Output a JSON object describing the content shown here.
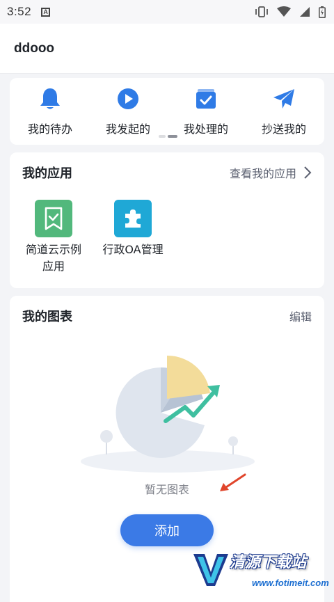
{
  "status_bar": {
    "time": "3:52",
    "icons": [
      "keyboard-a-icon",
      "vibrate-icon",
      "wifi-icon",
      "cell-signal-icon",
      "battery-icon"
    ]
  },
  "header": {
    "title": "ddooo"
  },
  "quick_actions": {
    "items": [
      {
        "label": "我的待办",
        "icon": "bell-icon"
      },
      {
        "label": "我发起的",
        "icon": "play-circle-icon"
      },
      {
        "label": "我处理的",
        "icon": "check-folder-icon"
      },
      {
        "label": "抄送我的",
        "icon": "paper-plane-icon"
      }
    ]
  },
  "my_apps": {
    "title": "我的应用",
    "view_all_label": "查看我的应用",
    "apps": [
      {
        "label": "简道云示例应用",
        "icon": "bookmark-check-icon",
        "color": "#52b87c"
      },
      {
        "label": "行政OA管理",
        "icon": "puzzle-icon",
        "color": "#1fa8d6"
      }
    ]
  },
  "my_charts": {
    "title": "我的图表",
    "edit_label": "编辑",
    "empty_text": "暂无图表",
    "add_label": "添加"
  },
  "colors": {
    "accent": "#3b7ae6",
    "icon_blue": "#2f7be6",
    "app_green": "#52b87c",
    "app_cyan": "#1fa8d6",
    "annotation_red": "#e0452b"
  },
  "watermark": {
    "title": "清源下载站",
    "url": "www.fotimeit.com"
  }
}
